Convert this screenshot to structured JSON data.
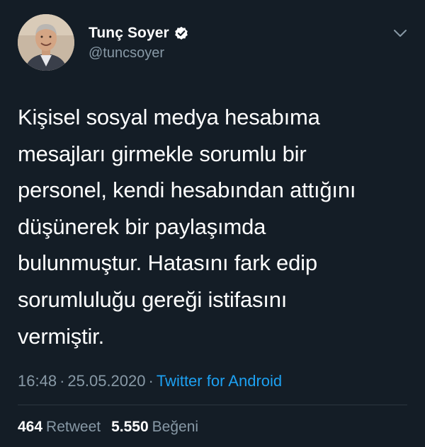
{
  "author": {
    "display_name": "Tunç Soyer",
    "handle": "@tuncsoyer",
    "verified": true,
    "avatar_icon": "profile-photo"
  },
  "tweet": {
    "text": "Kişisel sosyal medya hesabıma\nmesajları girmekle sorumlu bir\npersonel, kendi hesabından attığını\ndüşünerek bir paylaşımda\nbulunmuştur. Hatasını fark edip\nsorumluluğu gereği istifasını\nvermiştir.",
    "time": "16:48",
    "date": "25.05.2020",
    "separator": "·",
    "source": "Twitter for Android"
  },
  "stats": {
    "retweets_count": "464",
    "retweets_label": "Retweet",
    "likes_count": "5.550",
    "likes_label": "Beğeni"
  },
  "colors": {
    "background": "#141d26",
    "text_primary": "#ffffff",
    "text_secondary": "#8899a6",
    "accent": "#1da1f2",
    "divider": "#2c3640"
  }
}
